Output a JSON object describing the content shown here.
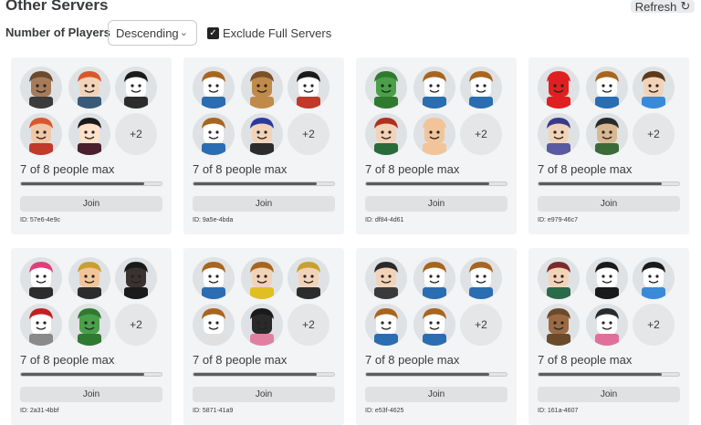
{
  "header": {
    "title": "Other Servers",
    "refresh_label": "Refresh",
    "refresh_icon": "refresh-icon"
  },
  "filters": {
    "sort_label": "Number of Players",
    "sort_value": "Descending",
    "exclude_full_label": "Exclude Full Servers",
    "exclude_full_checked": true
  },
  "colors": {
    "card_bg": "#f2f4f5",
    "text": "#393b3d",
    "bar_fill": "#5a5c5e",
    "button_bg": "#dfe1e3"
  },
  "servers": [
    {
      "id_text": "ID: 57e6-4e9c",
      "capacity_text": "7 of 8 people max",
      "players": 7,
      "max_players": 8,
      "extra_label": "+2",
      "join_label": "Join",
      "avatars": [
        {
          "skin": "#a57b5a",
          "hair": "#6b4a2e",
          "shirt": "#3b3b3b"
        },
        {
          "skin": "#f2d3b8",
          "hair": "#d9572a",
          "shirt": "#3a5a7a"
        },
        {
          "skin": "#ffffff",
          "hair": "#1a1a1a",
          "shirt": "#2c2c2c"
        },
        {
          "skin": "#f0c8a8",
          "hair": "#d9572a",
          "shirt": "#c0392b"
        },
        {
          "skin": "#ffe0c8",
          "hair": "#1a1a1a",
          "shirt": "#4a1f2e"
        }
      ]
    },
    {
      "id_text": "ID: 9a5e-4bda",
      "capacity_text": "7 of 8 people max",
      "players": 7,
      "max_players": 8,
      "extra_label": "+2",
      "join_label": "Join",
      "avatars": [
        {
          "skin": "#ffffff",
          "hair": "#a8651f",
          "shirt": "#2a6db0"
        },
        {
          "skin": "#c08a4a",
          "hair": "#7a5128",
          "shirt": "#c08a4a"
        },
        {
          "skin": "#ffffff",
          "hair": "#1a1a1a",
          "shirt": "#c0392b"
        },
        {
          "skin": "#ffffff",
          "hair": "#a8651f",
          "shirt": "#2a6db0"
        },
        {
          "skin": "#f2d3b8",
          "hair": "#2a3aa0",
          "shirt": "#2c2c2c"
        }
      ]
    },
    {
      "id_text": "ID: df84-4d61",
      "capacity_text": "7 of 8 people max",
      "players": 7,
      "max_players": 8,
      "extra_label": "+2",
      "join_label": "Join",
      "avatars": [
        {
          "skin": "#4aa04a",
          "hair": "#2f7a2f",
          "shirt": "#2f7a2f"
        },
        {
          "skin": "#ffffff",
          "hair": "#a8651f",
          "shirt": "#2a6db0"
        },
        {
          "skin": "#ffffff",
          "hair": "#a8651f",
          "shirt": "#2a6db0"
        },
        {
          "skin": "#f2d3b8",
          "hair": "#b03020",
          "shirt": "#2a6b3a"
        },
        {
          "skin": "#f2c49a",
          "hair": "#f2c49a",
          "shirt": "#f2c49a"
        }
      ]
    },
    {
      "id_text": "ID: e979-46c7",
      "capacity_text": "7 of 8 people max",
      "players": 7,
      "max_players": 8,
      "extra_label": "+2",
      "join_label": "Join",
      "avatars": [
        {
          "skin": "#e02020",
          "hair": "#e02020",
          "shirt": "#e02020"
        },
        {
          "skin": "#ffffff",
          "hair": "#a8651f",
          "shirt": "#2a6db0"
        },
        {
          "skin": "#f2d3b8",
          "hair": "#5a3a1a",
          "shirt": "#3a8ad8"
        },
        {
          "skin": "#f2d3b8",
          "hair": "#3a3a8a",
          "shirt": "#5a5aa0"
        },
        {
          "skin": "#d8b890",
          "hair": "#2a2a2a",
          "shirt": "#3a6a3a"
        }
      ]
    },
    {
      "id_text": "ID: 2a31-4bbf",
      "capacity_text": "7 of 8 people max",
      "players": 7,
      "max_players": 8,
      "extra_label": "+2",
      "join_label": "Join",
      "avatars": [
        {
          "skin": "#ffffff",
          "hair": "#e0407a",
          "shirt": "#2c2c2c"
        },
        {
          "skin": "#f2c49a",
          "hair": "#c8a030",
          "shirt": "#2c2c2c"
        },
        {
          "skin": "#3a3230",
          "hair": "#1a1a1a",
          "shirt": "#1a1a1a"
        },
        {
          "skin": "#ffffff",
          "hair": "#c02020",
          "shirt": "#8a8a8a"
        },
        {
          "skin": "#4aa04a",
          "hair": "#2f7a2f",
          "shirt": "#2f7a2f"
        }
      ]
    },
    {
      "id_text": "ID: 5871-41a9",
      "capacity_text": "7 of 8 people max",
      "players": 7,
      "max_players": 8,
      "extra_label": "+2",
      "join_label": "Join",
      "avatars": [
        {
          "skin": "#ffffff",
          "hair": "#a8651f",
          "shirt": "#2a6db0"
        },
        {
          "skin": "#f2d3b8",
          "hair": "#a8651f",
          "shirt": "#e0c020"
        },
        {
          "skin": "#f2d3b8",
          "hair": "#c8a030",
          "shirt": "#2c2c2c"
        },
        {
          "skin": "#ffffff",
          "hair": "#a8651f",
          "shirt": "#e0e0e0"
        },
        {
          "skin": "#2a2a2a",
          "hair": "#1a1a1a",
          "shirt": "#e080a0"
        }
      ]
    },
    {
      "id_text": "ID: e53f-4625",
      "capacity_text": "7 of 8 people max",
      "players": 7,
      "max_players": 8,
      "extra_label": "+2",
      "join_label": "Join",
      "avatars": [
        {
          "skin": "#f2d3b8",
          "hair": "#2a2a2a",
          "shirt": "#3a3a3a"
        },
        {
          "skin": "#ffffff",
          "hair": "#a8651f",
          "shirt": "#2a6db0"
        },
        {
          "skin": "#ffffff",
          "hair": "#a8651f",
          "shirt": "#2a6db0"
        },
        {
          "skin": "#ffffff",
          "hair": "#a8651f",
          "shirt": "#2a6db0"
        },
        {
          "skin": "#ffffff",
          "hair": "#a8651f",
          "shirt": "#2a6db0"
        }
      ]
    },
    {
      "id_text": "ID: 161a-4607",
      "capacity_text": "7 of 8 people max",
      "players": 7,
      "max_players": 8,
      "extra_label": "+2",
      "join_label": "Join",
      "avatars": [
        {
          "skin": "#f2d3b8",
          "hair": "#7a2a2a",
          "shirt": "#2a6b4a"
        },
        {
          "skin": "#ffffff",
          "hair": "#1a1a1a",
          "shirt": "#1a1a1a"
        },
        {
          "skin": "#ffffff",
          "hair": "#1a1a1a",
          "shirt": "#3a8ad8"
        },
        {
          "skin": "#9a6a44",
          "hair": "#6a4a2a",
          "shirt": "#6a4a2a"
        },
        {
          "skin": "#ffffff",
          "hair": "#2a2a2a",
          "shirt": "#e0709a"
        }
      ]
    }
  ]
}
